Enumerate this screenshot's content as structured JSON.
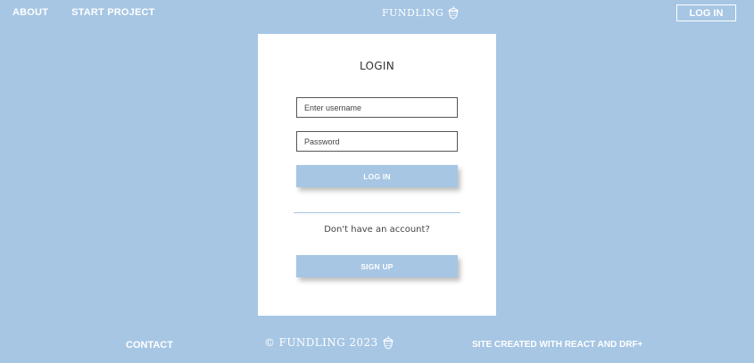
{
  "header": {
    "nav": {
      "about": "ABOUT",
      "start_project": "START PROJECT"
    },
    "brand": "FUNDLING",
    "brand_icon": "acorn-icon",
    "login_button": "LOG IN"
  },
  "card": {
    "title": "LOGIN",
    "username_placeholder": "Enter username",
    "password_placeholder": "Password",
    "login_button": "LOG IN",
    "no_account_text": "Don't have an account?",
    "signup_button": "SIGN UP"
  },
  "footer": {
    "contact": "CONTACT",
    "copyright": "© FUNDLING 2023",
    "credit": "SITE CREATED WITH REACT AND DRF+"
  },
  "colors": {
    "background": "#a6c6e4",
    "card": "#ffffff",
    "accent": "#a6c6e4",
    "text_on_accent": "#ffffff"
  }
}
